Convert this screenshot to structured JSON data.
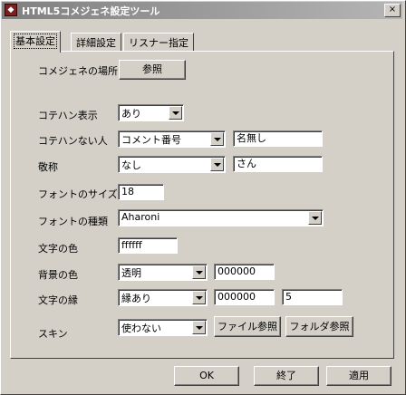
{
  "window": {
    "title": "HTML5コメジェネ設定ツール",
    "close_glyph": "×",
    "icon_glyph": "◆"
  },
  "tabs": [
    {
      "label": "基本設定",
      "active": true
    },
    {
      "label": "詳細設定",
      "active": false
    },
    {
      "label": "リスナー指定",
      "active": false
    }
  ],
  "settings": {
    "location": {
      "label": "コメジェネの場所",
      "browse_label": "参照"
    },
    "kotehan_display": {
      "label": "コテハン表示",
      "value": "あり"
    },
    "no_kotehan": {
      "label": "コテハンない人",
      "value": "コメント番号",
      "text": "名無し"
    },
    "honorific": {
      "label": "敬称",
      "value": "なし",
      "text": "さん"
    },
    "font_size": {
      "label": "フォントのサイズ",
      "value": "18"
    },
    "font_type": {
      "label": "フォントの種類",
      "value": "Aharoni"
    },
    "text_color": {
      "label": "文字の色",
      "value": "ffffff"
    },
    "bg_color": {
      "label": "背景の色",
      "value": "透明",
      "text": "000000"
    },
    "text_outline": {
      "label": "文字の縁",
      "value": "縁あり",
      "color": "000000",
      "width": "5"
    },
    "skin": {
      "label": "スキン",
      "value": "使わない",
      "file_browse_label": "ファイル参照",
      "folder_browse_label": "フォルダ参照"
    }
  },
  "footer": {
    "ok_label": "OK",
    "exit_label": "終了",
    "apply_label": "適用"
  }
}
